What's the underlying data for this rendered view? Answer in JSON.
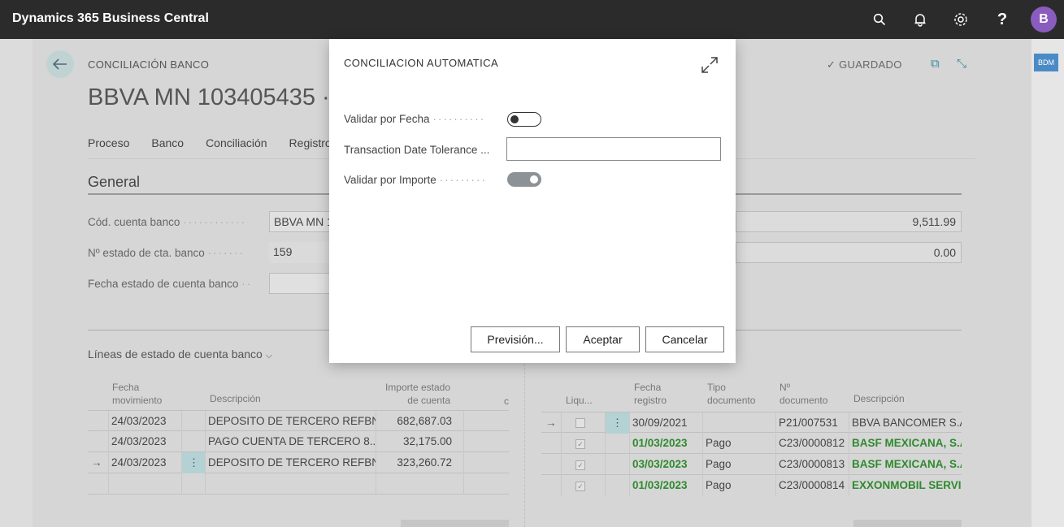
{
  "app": {
    "title": "Dynamics 365 Business Central",
    "avatar_initial": "B",
    "side_badge": "BDM"
  },
  "topbar_icons": [
    "search-icon",
    "bell-icon",
    "gear-icon",
    "help-icon"
  ],
  "page": {
    "breadcrumb": "CONCILIACIÓN BANCO",
    "title": "BBVA MN 103405435 · 1",
    "saved": "GUARDADO",
    "menu": [
      "Proceso",
      "Banco",
      "Conciliación",
      "Registro"
    ],
    "general_title": "General",
    "fields": [
      {
        "label": "Cód. cuenta banco",
        "value": "BBVA MN 1"
      },
      {
        "label": "Nº estado de cta. banco",
        "value": "159"
      },
      {
        "label": "Fecha estado de cuenta banco",
        "value": ""
      }
    ],
    "right_fields": [
      "9,511.99",
      "0.00"
    ],
    "lines_title": "Líneas de estado de cuenta banco",
    "left_grid": {
      "headers": {
        "date": "Fecha\nmovimiento",
        "desc": "Descripción",
        "amount": "Importe estado\nde cuenta",
        "extra": "c"
      },
      "rows": [
        {
          "date": "24/03/2023",
          "desc": "DEPOSITO DE TERCERO REFBN...",
          "amount": "682,687.03",
          "current": false
        },
        {
          "date": "24/03/2023",
          "desc": "PAGO CUENTA DE TERCERO  8...",
          "amount": "32,175.00",
          "current": false
        },
        {
          "date": "24/03/2023",
          "desc": "DEPOSITO DE TERCERO REFBN...",
          "amount": "323,260.72",
          "current": true
        }
      ]
    },
    "right_grid": {
      "headers": {
        "liq": "Liqu...",
        "date": "Fecha\nregistro",
        "type": "Tipo\ndocumento",
        "docno": "Nº\ndocumento",
        "desc": "Descripción"
      },
      "rows": [
        {
          "date": "30/09/2021",
          "type": "",
          "docno": "P21/007531",
          "desc": "BBVA BANCOMER S.A.",
          "green": false,
          "current": true
        },
        {
          "date": "01/03/2023",
          "type": "Pago",
          "docno": "C23/0000812",
          "desc": "BASF MEXICANA, S.A",
          "green": true,
          "current": false
        },
        {
          "date": "03/03/2023",
          "type": "Pago",
          "docno": "C23/0000813",
          "desc": "BASF MEXICANA, S.A",
          "green": true,
          "current": false
        },
        {
          "date": "01/03/2023",
          "type": "Pago",
          "docno": "C23/0000814",
          "desc": "EXXONMOBIL SERVI",
          "green": true,
          "current": false
        }
      ]
    }
  },
  "modal": {
    "title": "CONCILIACION AUTOMATICA",
    "fields": [
      {
        "label": "Validar por Fecha",
        "type": "toggle",
        "on": false
      },
      {
        "label": "Transaction Date Tolerance ...",
        "type": "input",
        "value": ""
      },
      {
        "label": "Validar por Importe",
        "type": "toggle",
        "on": true
      }
    ],
    "buttons": {
      "preview": "Previsión...",
      "accept": "Aceptar",
      "cancel": "Cancelar"
    }
  }
}
